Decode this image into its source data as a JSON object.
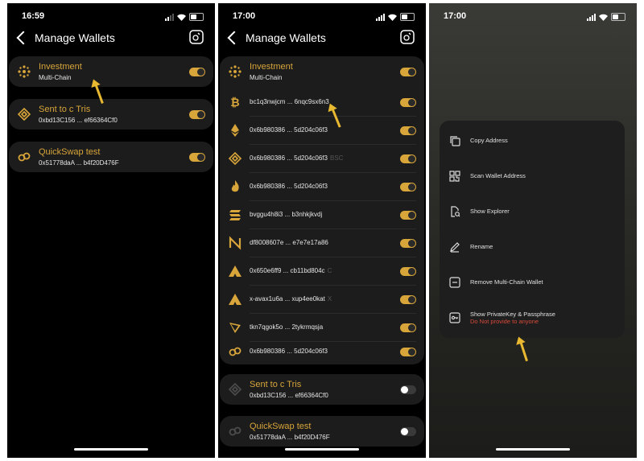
{
  "colors": {
    "accent": "#d8a53a",
    "warning": "#d64a3a",
    "arrow": "#e8b830"
  },
  "screen1": {
    "time": "16:59",
    "title": "Manage Wallets",
    "wallets": [
      {
        "name": "Investment",
        "sub": "Multi-Chain",
        "icon": "dots-cluster-icon",
        "enabled": true
      },
      {
        "name": "Sent to c Tris",
        "sub": "0xbd13C156 ... ef66364Cf0",
        "icon": "bnb-icon",
        "enabled": true
      },
      {
        "name": "QuickSwap test",
        "sub": "0x51778daA ... b4f20D476F",
        "icon": "chain-link-icon",
        "enabled": true
      }
    ]
  },
  "screen2": {
    "time": "17:00",
    "title": "Manage Wallets",
    "multichain": {
      "name": "Investment",
      "sub": "Multi-Chain",
      "enabled": true,
      "addresses": [
        {
          "icon": "bitcoin-icon",
          "addr": "bc1q3nwjcm ... 6nqc9sx6n3",
          "tag": "",
          "enabled": true
        },
        {
          "icon": "ethereum-icon",
          "addr": "0x6b980386 ... 5d204c06f3",
          "tag": "",
          "enabled": true
        },
        {
          "icon": "bnb-icon",
          "addr": "0x6b980386 ... 5d204c06f3",
          "tag": "BSC",
          "enabled": true
        },
        {
          "icon": "flame-icon",
          "addr": "0x6b980386 ... 5d204c06f3",
          "tag": "",
          "enabled": true
        },
        {
          "icon": "solana-icon",
          "addr": "bvggu4h8i3 ... b3nhkjkvdj",
          "tag": "",
          "enabled": true
        },
        {
          "icon": "near-icon",
          "addr": "df8008607e ... e7e7e17a86",
          "tag": "",
          "enabled": true
        },
        {
          "icon": "avalanche-icon",
          "addr": "0x650e6ff9 ... cb11bd804c",
          "tag": "C",
          "enabled": true
        },
        {
          "icon": "avalanche-icon",
          "addr": "x-avax1u6a ... xup4ee0kat",
          "tag": "X",
          "enabled": true
        },
        {
          "icon": "tron-icon",
          "addr": "tkn7qgok5o ... 2tykrmqsja",
          "tag": "",
          "enabled": true
        },
        {
          "icon": "chain-link-icon",
          "addr": "0x6b980386 ... 5d204c06f3",
          "tag": "",
          "enabled": true
        }
      ]
    },
    "others": [
      {
        "name": "Sent to c Tris",
        "sub": "0xbd13C156 ... ef66364Cf0",
        "icon": "bnb-icon",
        "enabled": false
      },
      {
        "name": "QuickSwap test",
        "sub": "0x51778daA ... b4f20D476F",
        "icon": "chain-link-icon",
        "enabled": false
      }
    ]
  },
  "screen3": {
    "time": "17:00",
    "menu": [
      {
        "label": "Copy Address",
        "icon": "copy-icon"
      },
      {
        "label": "Scan Wallet Address",
        "icon": "qr-code-icon"
      },
      {
        "label": "Show Explorer",
        "icon": "explorer-icon"
      },
      {
        "label": "Rename",
        "icon": "pencil-icon"
      },
      {
        "label": "Remove Multi-Chain Wallet",
        "icon": "minus-box-icon"
      },
      {
        "label": "Show PrivateKey & Passphrase",
        "icon": "key-icon",
        "warning": "Do Not provide to anyone"
      }
    ]
  }
}
